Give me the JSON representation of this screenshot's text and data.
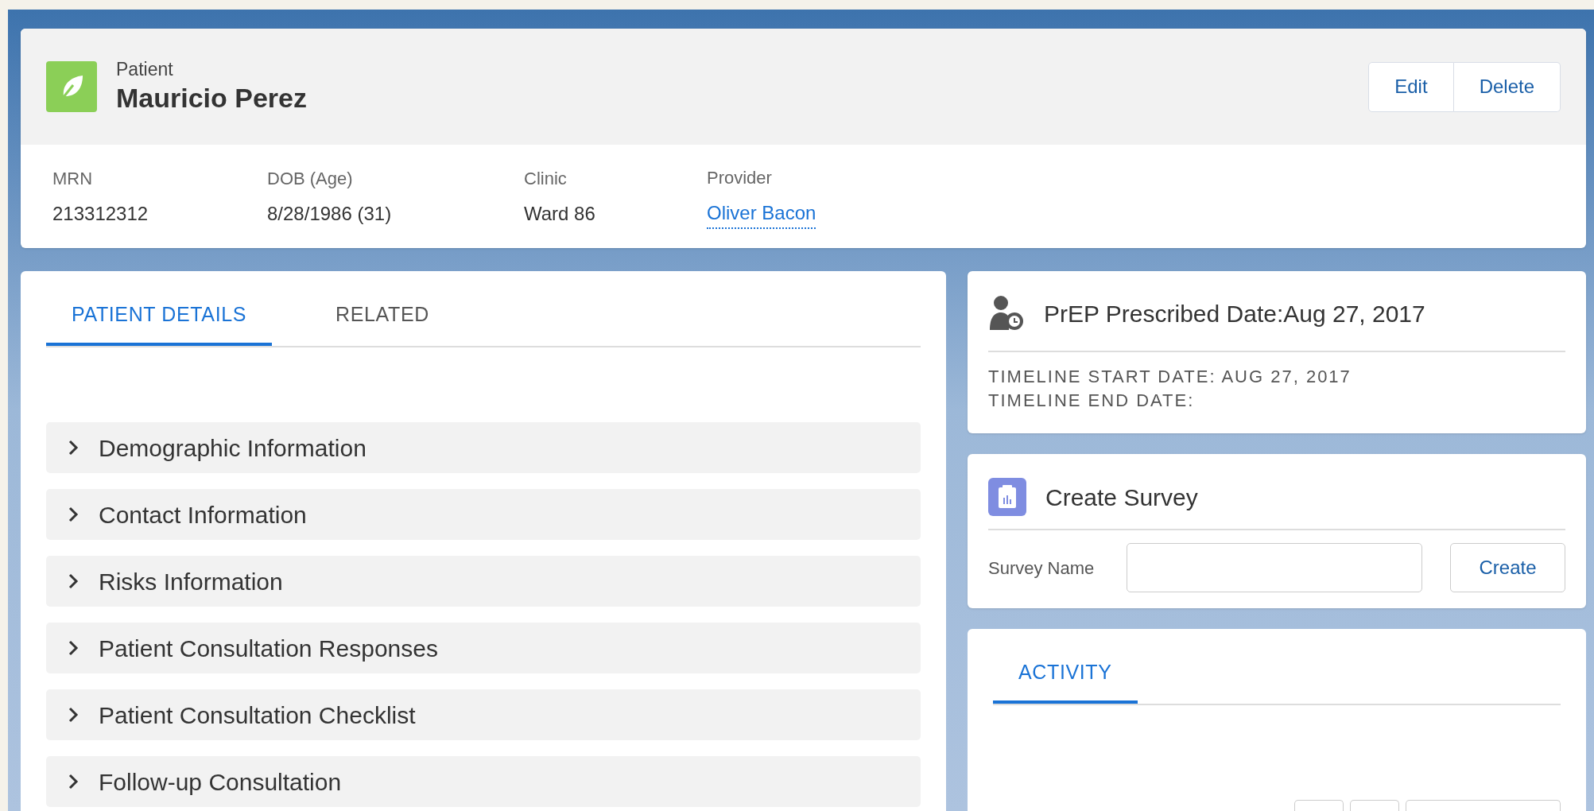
{
  "header": {
    "object_type": "Patient",
    "name": "Mauricio Perez",
    "actions": [
      "Edit",
      "Delete"
    ],
    "fields": [
      {
        "label": "MRN",
        "value": "213312312",
        "kind": "text"
      },
      {
        "label": "DOB (Age)",
        "value": "8/28/1986 (31)",
        "kind": "text"
      },
      {
        "label": "Clinic",
        "value": "Ward 86",
        "kind": "text"
      },
      {
        "label": "Provider",
        "value": "Oliver Bacon",
        "kind": "link"
      }
    ]
  },
  "details": {
    "tabs": [
      {
        "label": "PATIENT DETAILS",
        "selected": true
      },
      {
        "label": "RELATED",
        "selected": false
      }
    ],
    "sections": [
      {
        "title": "Demographic Information",
        "expanded": false
      },
      {
        "title": "Contact Information",
        "expanded": false
      },
      {
        "title": "Risks Information",
        "expanded": false
      },
      {
        "title": "Patient Consultation Responses",
        "expanded": false
      },
      {
        "title": "Patient Consultation Checklist",
        "expanded": false
      },
      {
        "title": "Follow-up Consultation",
        "expanded": false
      }
    ]
  },
  "prep_card": {
    "title": "PrEP Prescribed Date:Aug 27, 2017",
    "lines": [
      "TIMELINE START DATE: AUG 27, 2017",
      "TIMELINE END DATE:"
    ]
  },
  "survey_card": {
    "title": "Create Survey",
    "field_label": "Survey Name",
    "button": "Create"
  },
  "activity_card": {
    "tabs": [
      {
        "label": "ACTIVITY",
        "selected": true
      }
    ]
  }
}
